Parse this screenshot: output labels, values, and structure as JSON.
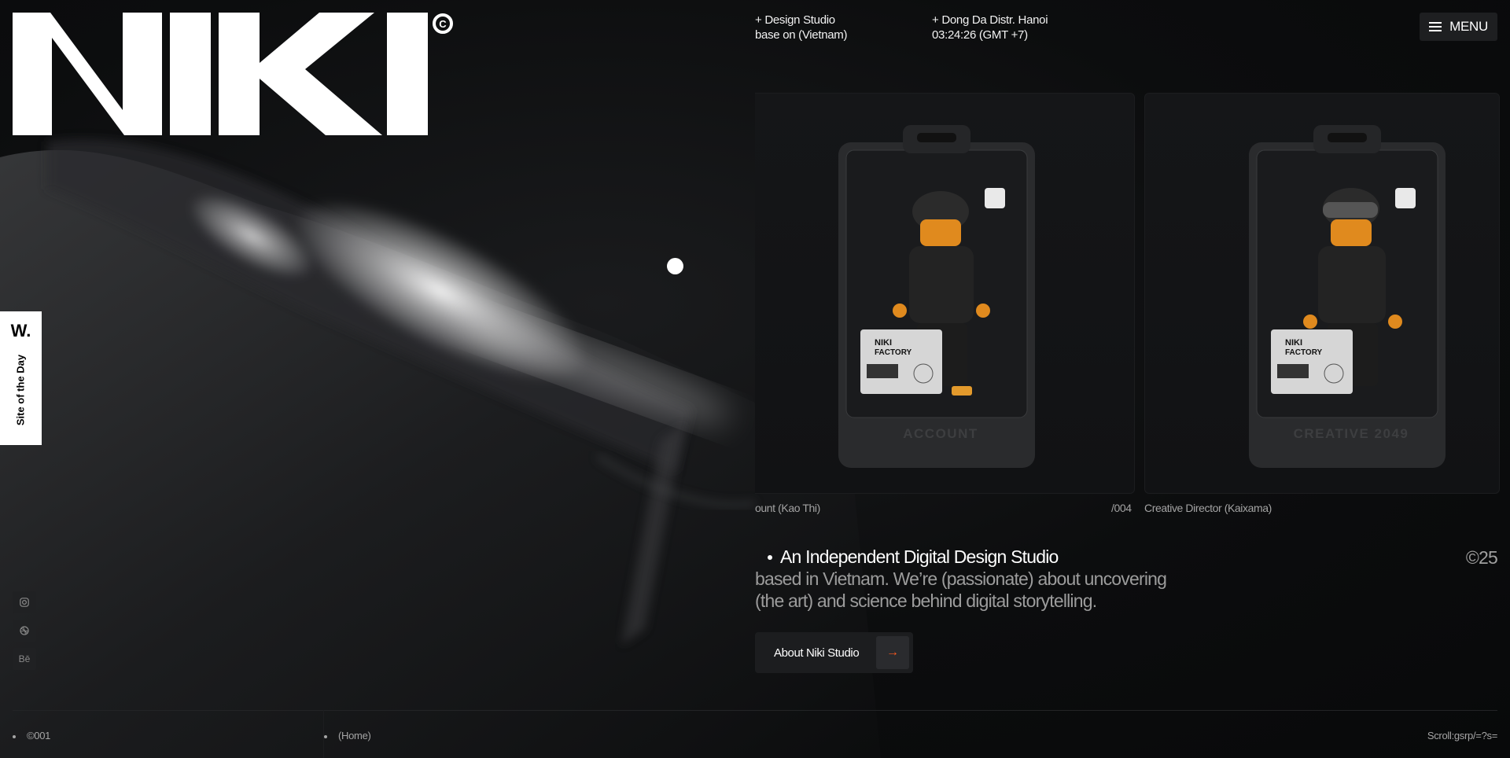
{
  "brand": {
    "logo_text": "NIKI",
    "logo_mark": "©"
  },
  "header": {
    "studio_line1": "+ Design Studio",
    "studio_line2": "base on (Vietnam)",
    "location_line1": "+ Dong Da Distr. Hanoi",
    "location_line2": "03:24:26 (GMT +7)",
    "menu_label": "MENU",
    "menu_icon": "hamburger-icon"
  },
  "badge": {
    "letter": "W.",
    "label": "Site of the Day"
  },
  "social": [
    {
      "icon": "instagram-icon",
      "glyph": "◎"
    },
    {
      "icon": "dribbble-icon",
      "glyph": "⊕"
    },
    {
      "icon": "behance-icon",
      "glyph": "Bē"
    }
  ],
  "cards": [
    {
      "caption": "ount (Kao Thi)",
      "index": "/004",
      "box_label": "ACCOUNT",
      "tag": "FACTORY",
      "brand": "NIKI"
    },
    {
      "caption": "Creative Director (Kaixama)",
      "box_label": "CREATIVE 2049",
      "tag": "FACTORY",
      "brand": "NIKI"
    }
  ],
  "intro": {
    "lead": "An Independent Digital Design Studio",
    "line2": "based in Vietnam. We’re (passionate) about uncovering",
    "line3": "(the art) and science behind digital storytelling.",
    "year": "©25"
  },
  "cta": {
    "label": "About Niki Studio",
    "arrow": "→",
    "accent": "#ff5a1f"
  },
  "footer": {
    "index": "©001",
    "page": "(Home)",
    "scroll": "Scroll:gsrp/=?s="
  }
}
